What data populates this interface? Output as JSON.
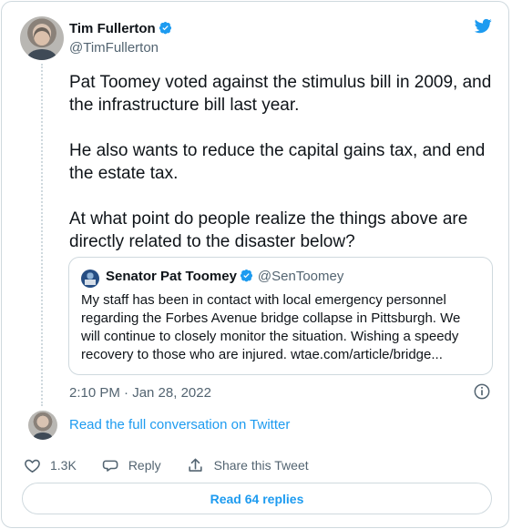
{
  "tweet": {
    "author": {
      "name": "Tim Fullerton",
      "handle": "@TimFullerton"
    },
    "text_paragraphs": [
      "Pat Toomey voted against the stimulus bill in 2009, and the infrastructure bill last year.",
      "He also wants to reduce the capital gains tax, and end the estate tax.",
      "At what point do people realize the things above are directly related to the disaster below?"
    ],
    "quoted": {
      "name": "Senator Pat Toomey",
      "handle": "@SenToomey",
      "text": "My staff has been in contact with local emergency personnel regarding the Forbes Avenue bridge collapse in Pittsburgh. We will continue to closely monitor the situation. Wishing a speedy recovery to those who are injured. wtae.com/article/bridge..."
    },
    "timestamp": "2:10 PM · Jan 28, 2022",
    "read_full_conversation": "Read the full conversation on Twitter",
    "actions": {
      "likes": "1.3K",
      "reply": "Reply",
      "share": "Share this Tweet"
    },
    "read_replies": "Read 64 replies"
  },
  "icons": {
    "brand": "twitter-bird-icon",
    "verified": "verified-badge-icon",
    "info": "info-icon",
    "like": "heart-icon",
    "reply": "reply-icon",
    "share": "share-icon"
  },
  "colors": {
    "accent": "#1d9bf0",
    "text": "#0f1419",
    "secondary_text": "#536471",
    "border": "#cfd9de"
  }
}
